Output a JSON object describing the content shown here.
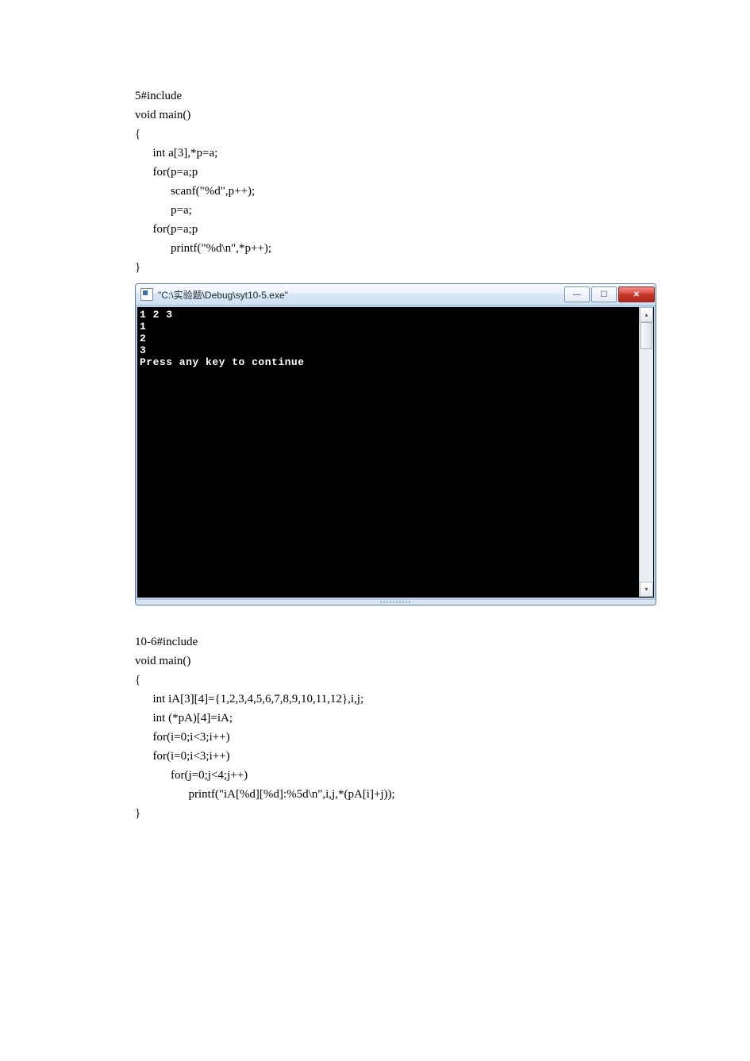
{
  "code1": {
    "line1": "5#include",
    "line2": "void main()",
    "line3": "{",
    "line4": "      int a[3],*p=a;",
    "line5": "      for(p=a;p",
    "line6": "            scanf(\"%d\",p++);",
    "line7": "            p=a;",
    "line8": "      for(p=a;p",
    "line9": "            printf(\"%d\\n\",*p++);",
    "line10": "}"
  },
  "console": {
    "title": "\"C:\\实验题\\Debug\\syt10-5.exe\"",
    "output_line1": "1 2 3",
    "output_line2": "1",
    "output_line3": "2",
    "output_line4": "3",
    "output_line5": "Press any key to continue",
    "buttons": {
      "minimize_glyph": "—",
      "maximize_glyph": "☐",
      "close_glyph": "✕"
    },
    "scroll": {
      "up_glyph": "▴",
      "down_glyph": "▾"
    }
  },
  "code2": {
    "line1": "10-6#include",
    "line2": "void main()",
    "line3": "{",
    "line4": "      int iA[3][4]={1,2,3,4,5,6,7,8,9,10,11,12},i,j;",
    "line5": "      int (*pA)[4]=iA;",
    "line6": "      for(i=0;i<3;i++)",
    "line7": "      for(i=0;i<3;i++)",
    "line8": "            for(j=0;j<4;j++)",
    "line9": "                  printf(\"iA[%d][%d]:%5d\\n\",i,j,*(pA[i]+j));",
    "line10": "}"
  }
}
